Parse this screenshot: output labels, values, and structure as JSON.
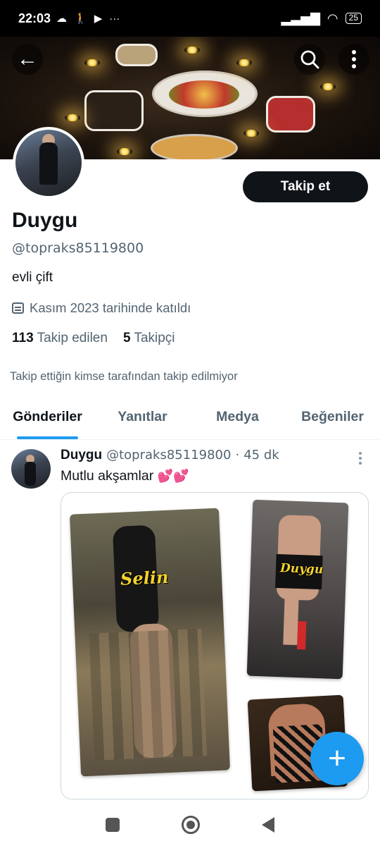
{
  "status_bar": {
    "time": "22:03",
    "battery": "25"
  },
  "profile": {
    "name": "Duygu",
    "handle": "@topraks85119800",
    "bio": "evli çift",
    "joined": "Kasım 2023 tarihinde katıldı",
    "following_count": "113",
    "following_label": "Takip edilen",
    "followers_count": "5",
    "followers_label": "Takipçi",
    "not_followed_text": "Takip ettiğin kimse tarafından takip edilmiyor",
    "follow_button": "Takip et"
  },
  "tabs": [
    {
      "label": "Gönderiler",
      "active": true
    },
    {
      "label": "Yanıtlar",
      "active": false
    },
    {
      "label": "Medya",
      "active": false
    },
    {
      "label": "Beğeniler",
      "active": false
    }
  ],
  "post": {
    "author": "Duygu",
    "handle": "@topraks85119800",
    "separator": "·",
    "time": "45 dk",
    "text": "Mutlu akşamlar",
    "emoji": "💕💕",
    "photo_labels": [
      "Selin",
      "Duygu"
    ]
  },
  "icons": {
    "back": "back-arrow-icon",
    "search": "search-icon",
    "more": "more-vertical-icon",
    "compose": "plus-icon",
    "accent": "#1d9bf0"
  }
}
